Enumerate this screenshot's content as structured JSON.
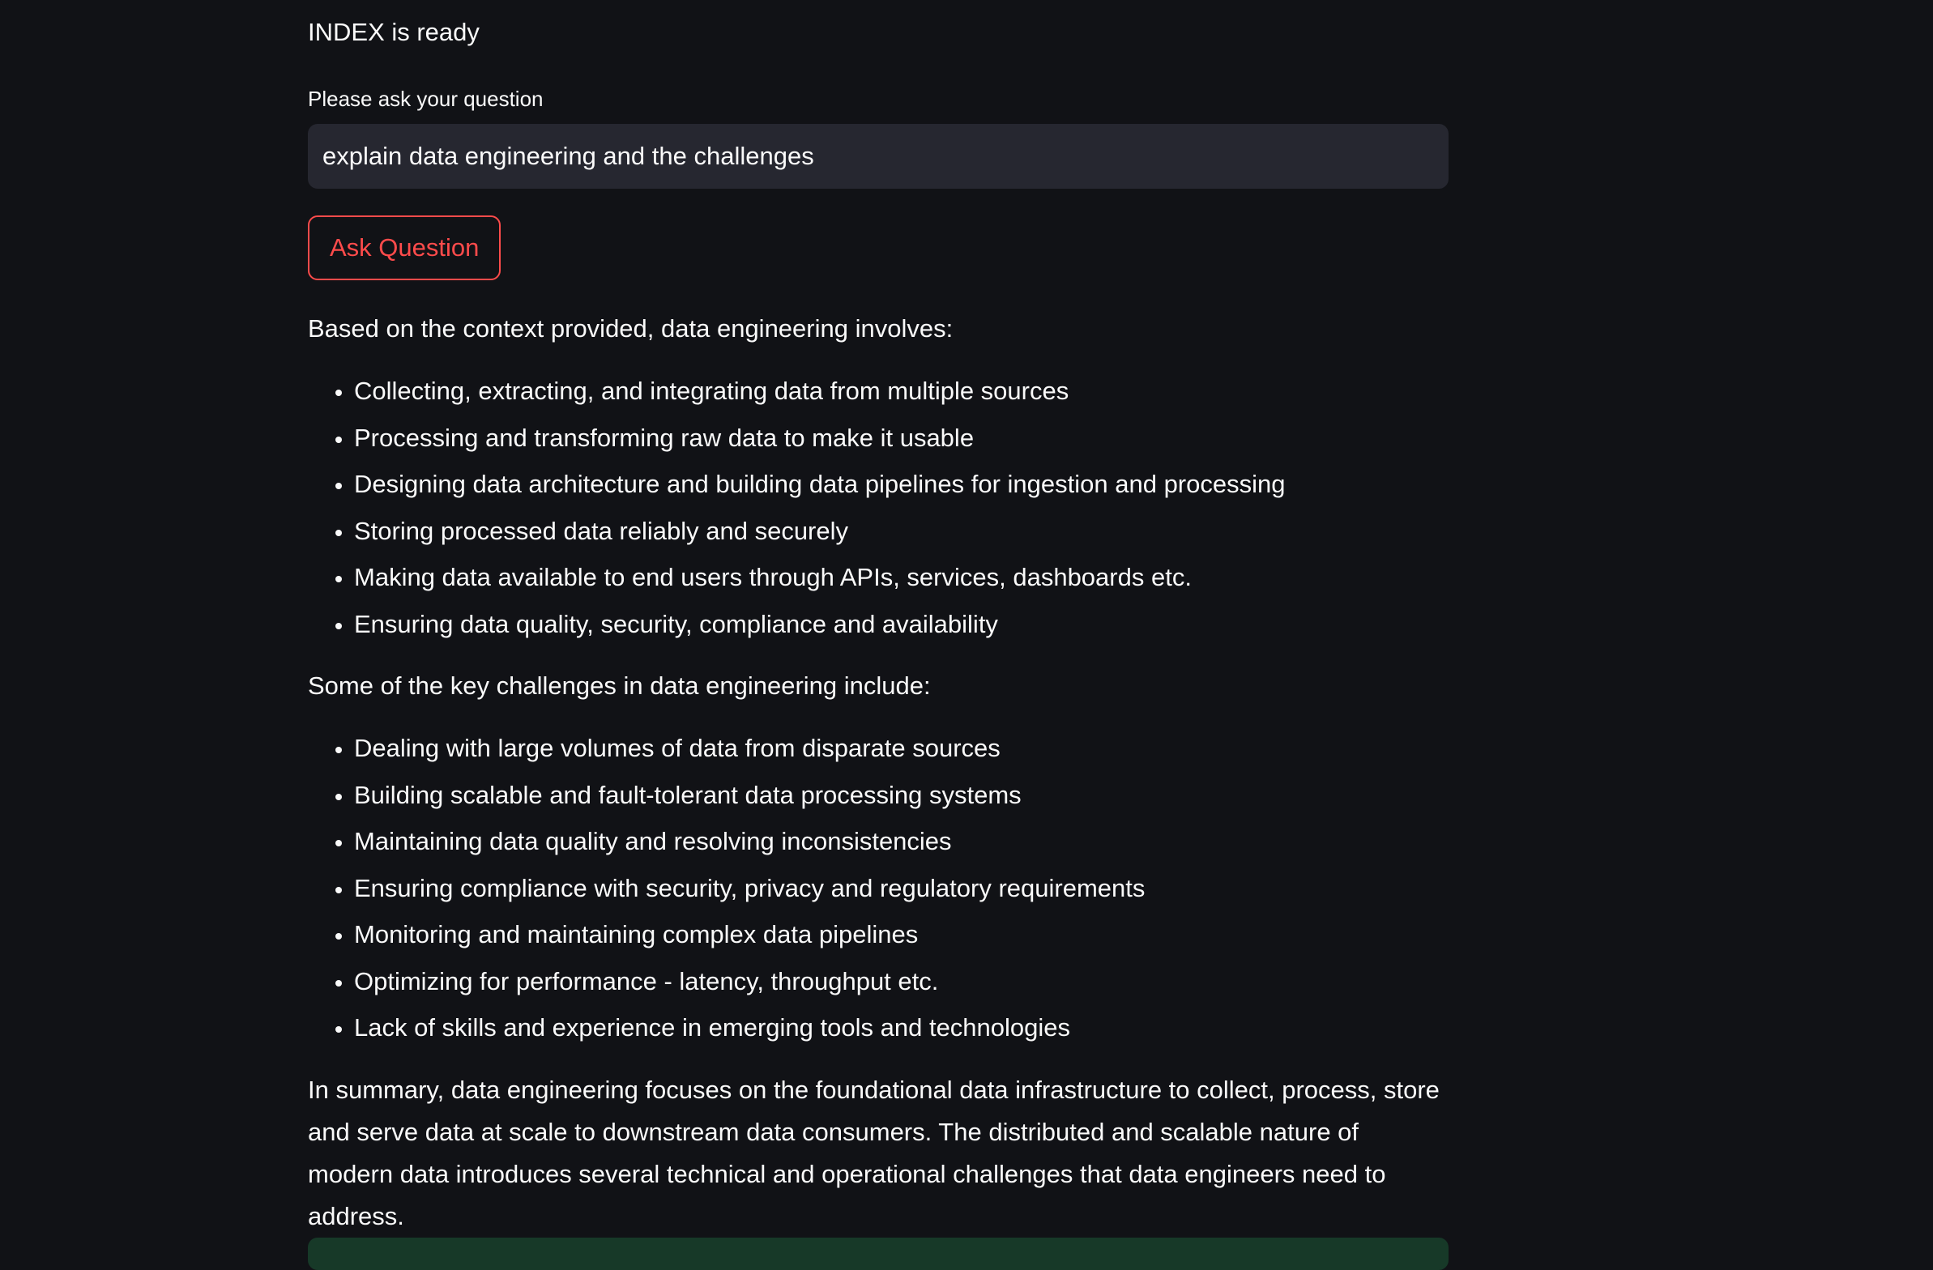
{
  "status": "INDEX is ready",
  "question_input": {
    "label": "Please ask your question",
    "value": "explain data engineering and the challenges"
  },
  "ask_button_label": "Ask Question",
  "answer": {
    "intro": "Based on the context provided, data engineering involves:",
    "involves": [
      "Collecting, extracting, and integrating data from multiple sources",
      "Processing and transforming raw data to make it usable",
      "Designing data architecture and building data pipelines for ingestion and processing",
      "Storing processed data reliably and securely",
      "Making data available to end users through APIs, services, dashboards etc.",
      "Ensuring data quality, security, compliance and availability"
    ],
    "challenges_intro": "Some of the key challenges in data engineering include:",
    "challenges": [
      "Dealing with large volumes of data from disparate sources",
      "Building scalable and fault-tolerant data processing systems",
      "Maintaining data quality and resolving inconsistencies",
      "Ensuring compliance with security, privacy and regulatory requirements",
      "Monitoring and maintaining complex data pipelines",
      "Optimizing for performance - latency, throughput etc.",
      "Lack of skills and experience in emerging tools and technologies"
    ],
    "summary": "In summary, data engineering focuses on the foundational data infrastructure to collect, process, store and serve data at scale to downstream data consumers. The distributed and scalable nature of modern data introduces several technical and operational challenges that data engineers need to address."
  },
  "colors": {
    "background": "#111216",
    "text": "#fafafa",
    "input_bg": "#262730",
    "accent": "#ff4b4b",
    "success_bg": "#173928"
  }
}
